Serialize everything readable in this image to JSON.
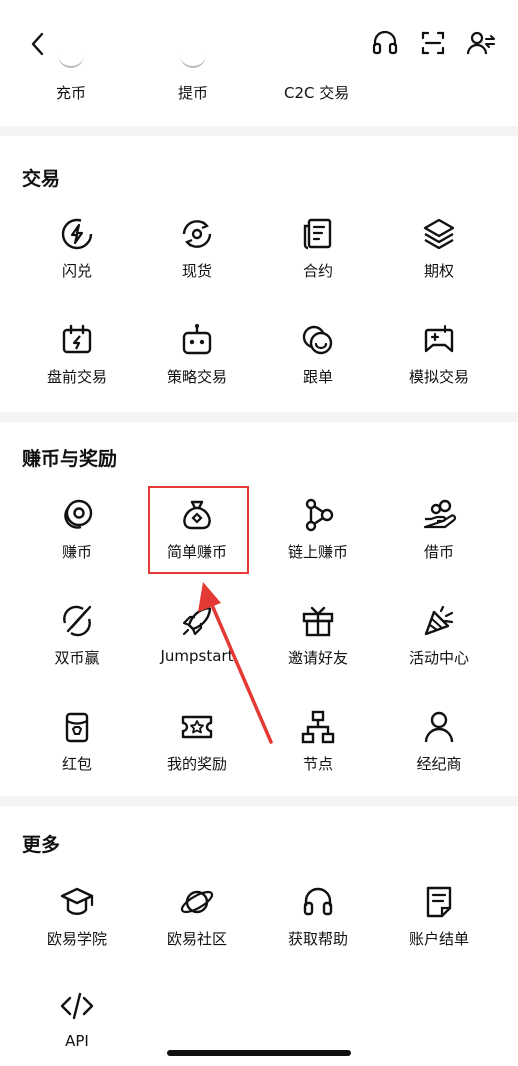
{
  "top_partial": [
    {
      "label": "充币"
    },
    {
      "label": "提币"
    },
    {
      "label": "C2C 交易"
    }
  ],
  "sections": {
    "trade": {
      "title": "交易",
      "items": [
        {
          "label": "闪兑",
          "icon": "flash-icon"
        },
        {
          "label": "现货",
          "icon": "spot-icon"
        },
        {
          "label": "合约",
          "icon": "contract-icon"
        },
        {
          "label": "期权",
          "icon": "layers-icon"
        },
        {
          "label": "盘前交易",
          "icon": "premarket-icon"
        },
        {
          "label": "策略交易",
          "icon": "robot-icon"
        },
        {
          "label": "跟单",
          "icon": "copy-trade-icon"
        },
        {
          "label": "模拟交易",
          "icon": "demo-trade-icon"
        }
      ]
    },
    "earn": {
      "title": "赚币与奖励",
      "items": [
        {
          "label": "赚币",
          "icon": "coin-icon"
        },
        {
          "label": "简单赚币",
          "icon": "money-bag-icon"
        },
        {
          "label": "链上赚币",
          "icon": "onchain-icon"
        },
        {
          "label": "借币",
          "icon": "loan-icon"
        },
        {
          "label": "双币赢",
          "icon": "dual-coin-icon"
        },
        {
          "label": "Jumpstart",
          "icon": "rocket-icon"
        },
        {
          "label": "邀请好友",
          "icon": "gift-icon"
        },
        {
          "label": "活动中心",
          "icon": "party-icon"
        },
        {
          "label": "红包",
          "icon": "red-packet-icon"
        },
        {
          "label": "我的奖励",
          "icon": "ticket-icon"
        },
        {
          "label": "节点",
          "icon": "node-icon"
        },
        {
          "label": "经纪商",
          "icon": "broker-icon"
        }
      ]
    },
    "more": {
      "title": "更多",
      "items": [
        {
          "label": "欧易学院",
          "icon": "academy-icon"
        },
        {
          "label": "欧易社区",
          "icon": "planet-icon"
        },
        {
          "label": "获取帮助",
          "icon": "headset-icon"
        },
        {
          "label": "账户结单",
          "icon": "statement-icon"
        },
        {
          "label": "API",
          "icon": "code-icon"
        }
      ]
    }
  },
  "colors": {
    "highlight": "#e53935",
    "text": "#111111"
  }
}
